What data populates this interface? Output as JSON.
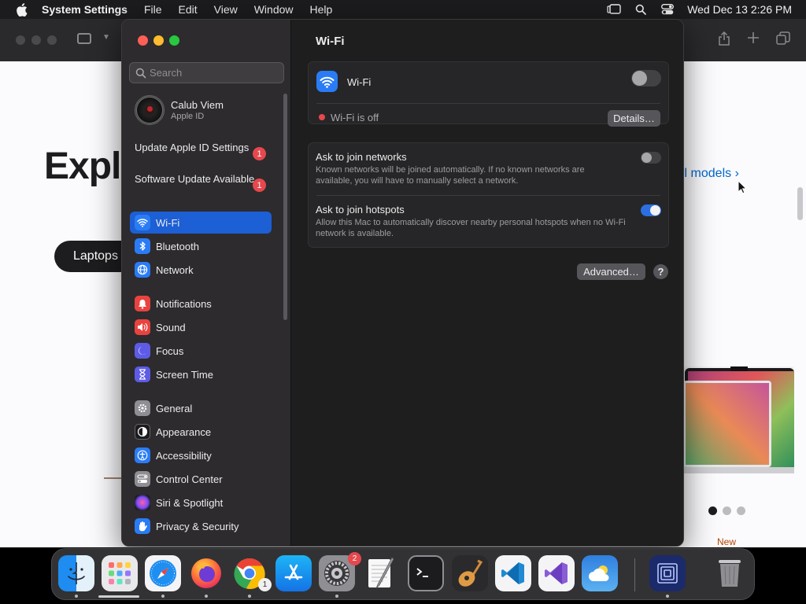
{
  "menubar": {
    "app_name": "System Settings",
    "menus": [
      "File",
      "Edit",
      "View",
      "Window",
      "Help"
    ],
    "clock": "Wed Dec 13  2:26 PM"
  },
  "browser": {
    "headline": "Exple",
    "pill_label": "Laptops",
    "models_link": "ll models ›",
    "new_tag": "New"
  },
  "settings": {
    "search_placeholder": "Search",
    "account": {
      "name": "Calub Viem",
      "subtitle": "Apple ID"
    },
    "notices": [
      {
        "label": "Update Apple ID Settings",
        "count": "1"
      },
      {
        "label": "Software Update Available",
        "count": "1"
      }
    ],
    "sidebar": {
      "group1": [
        "Wi-Fi",
        "Bluetooth",
        "Network"
      ],
      "group2": [
        "Notifications",
        "Sound",
        "Focus",
        "Screen Time"
      ],
      "group3": [
        "General",
        "Appearance",
        "Accessibility",
        "Control Center",
        "Siri & Spotlight",
        "Privacy & Security"
      ],
      "selected": "Wi-Fi"
    },
    "page_title": "Wi-Fi",
    "wifi": {
      "label": "Wi-Fi",
      "enabled": false,
      "status": "Wi-Fi is off",
      "details_button": "Details…"
    },
    "ask_networks": {
      "title": "Ask to join networks",
      "description": "Known networks will be joined automatically. If no known networks are available, you will have to manually select a network.",
      "enabled": false
    },
    "ask_hotspots": {
      "title": "Ask to join hotspots",
      "description": "Allow this Mac to automatically discover nearby personal hotspots when no Wi-Fi network is available.",
      "enabled": true
    },
    "advanced_button": "Advanced…",
    "help_button": "?"
  },
  "dock": {
    "apps": [
      "finder-icon",
      "launchpad-icon",
      "safari-icon",
      "firefox-icon",
      "chrome-icon",
      "app-store-icon",
      "system-settings-icon",
      "textedit-icon",
      "terminal-icon",
      "garageband-icon",
      "vscode-icon",
      "visual-studio-icon",
      "weather-icon",
      "screen-share-icon",
      "trash-icon"
    ],
    "system_settings_badge": "2",
    "chrome_badge": "1"
  },
  "colors": {
    "accent": "#1d5fd4",
    "badge": "#e5484d",
    "status_off": "#e5484d",
    "toggle_on": "#2c6fe0"
  }
}
